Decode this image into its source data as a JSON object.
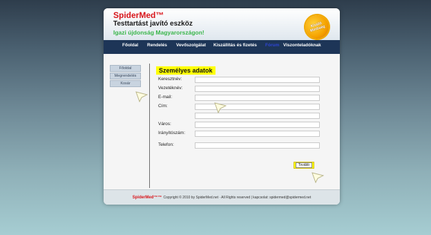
{
  "header": {
    "brand": "SpiderMed™",
    "tagline": "Testtartást javító eszköz",
    "subtag": "Igazi újdonság Magyarországon!",
    "badge_line1": "Kiváló",
    "badge_line2": "Minőség"
  },
  "nav": {
    "items": [
      {
        "label": "Főoldal"
      },
      {
        "label": "Rendelés"
      },
      {
        "label": "Vevőszolgálat"
      },
      {
        "label": "Kiszállítás és fizetés"
      },
      {
        "label": "Fórum"
      },
      {
        "label": "Viszonteladóknak"
      }
    ]
  },
  "sidebar": {
    "items": [
      {
        "label": "Főoldal"
      },
      {
        "label": "Megrendelés"
      },
      {
        "label": "Kosár"
      }
    ]
  },
  "form": {
    "title": "Személyes adatok",
    "fields": [
      {
        "label": "Keresztnév:",
        "value": ""
      },
      {
        "label": "Vezetéknév:",
        "value": ""
      },
      {
        "label": "E-mail:",
        "value": ""
      },
      {
        "label": "Cím:",
        "value": ""
      },
      {
        "label": "",
        "value": ""
      },
      {
        "label": "Város:",
        "value": ""
      },
      {
        "label": "Irányítószám:",
        "value": ""
      },
      {
        "label": "Telefon:",
        "value": ""
      }
    ],
    "submit_label": "Tovább"
  },
  "footer": {
    "brand": "SpiderMed™™",
    "text": "Copyright © 2010 by SpiderMed.net · All Rights reserved | kapcsolat: spidermed@spidermed.net"
  },
  "colors": {
    "brand_red": "#d8141a",
    "nav_bg": "#1d3557",
    "highlight_yellow": "#ffff00",
    "subtag_green": "#39b54a"
  }
}
